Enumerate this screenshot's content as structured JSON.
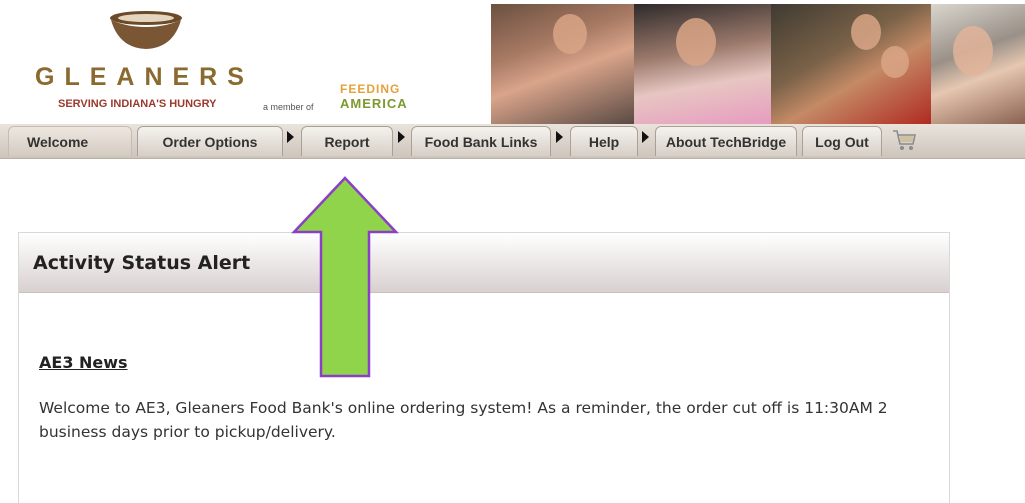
{
  "brand": {
    "name": "GLEANERS",
    "tagline": "SERVING INDIANA'S HUNGRY",
    "member_of": "a member of",
    "partner_line1": "FEEDING",
    "partner_line2": "AMERICA",
    "bowl_icon": "bowl-icon",
    "colors": {
      "brand_brown": "#8a6a2e",
      "tagline_red": "#9a3a2c",
      "feeding_orange": "#e5a23a",
      "america_green": "#7d9a2f"
    }
  },
  "nav": {
    "tabs": [
      {
        "label": "Welcome"
      },
      {
        "label": "Order Options"
      },
      {
        "label": "Report"
      },
      {
        "label": "Food Bank Links"
      },
      {
        "label": "Help"
      },
      {
        "label": "About TechBridge"
      },
      {
        "label": "Log Out"
      }
    ],
    "cart_icon": "shopping-cart-icon",
    "arrow_icon": "triangle-right-icon"
  },
  "alert": {
    "title": "Activity Status Alert",
    "news_title": "AE3 News",
    "news_body": "Welcome to AE3, Gleaners Food Bank's online ordering system! As a reminder, the order cut off is 11:30AM 2 business days prior to pickup/delivery."
  },
  "annotation": {
    "icon": "up-arrow-annotation-icon",
    "fill": "#8fd44a",
    "stroke": "#8b3fc7"
  }
}
